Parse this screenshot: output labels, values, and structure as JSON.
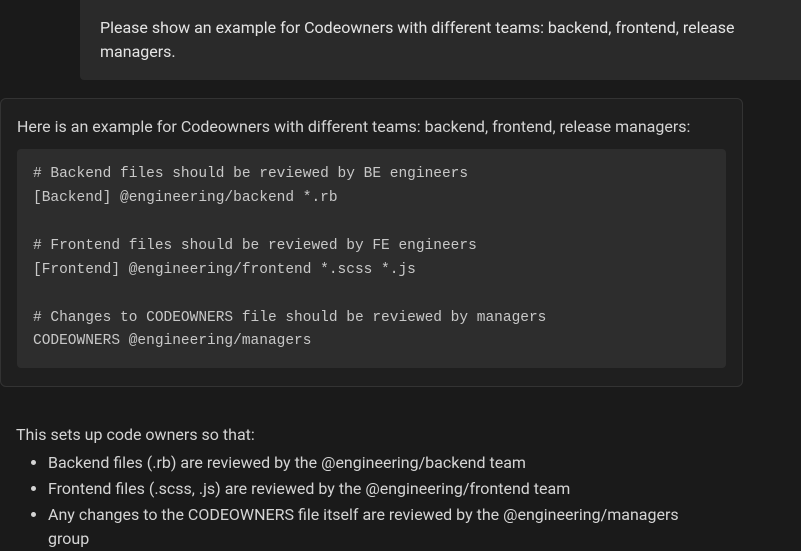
{
  "user": {
    "prompt": "Please show an example for Codeowners with different teams: backend, frontend, release managers."
  },
  "assistant": {
    "intro": "Here is an example for Codeowners with different teams: backend, frontend, release managers:",
    "code": "# Backend files should be reviewed by BE engineers\n[Backend] @engineering/backend *.rb\n\n# Frontend files should be reviewed by FE engineers\n[Frontend] @engineering/frontend *.scss *.js\n\n# Changes to CODEOWNERS file should be reviewed by managers\nCODEOWNERS @engineering/managers",
    "outro": "This sets up code owners so that:",
    "bullets": [
      "Backend files (.rb) are reviewed by the @engineering/backend team",
      "Frontend files (.scss, .js) are reviewed by the @engineering/frontend team",
      "Any changes to the CODEOWNERS file itself are reviewed by the @engineering/managers group"
    ]
  }
}
